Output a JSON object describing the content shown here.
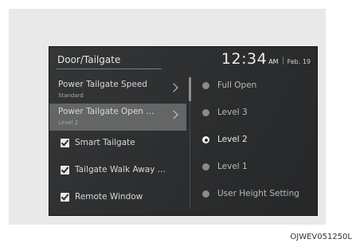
{
  "header": {
    "title": "Door/Tailgate",
    "time": "12:34",
    "ampm": "AM",
    "date": "Feb. 19"
  },
  "left_menu": [
    {
      "label": "Power Tailgate Speed",
      "sub": "Standard",
      "type": "submenu",
      "selected": false
    },
    {
      "label": "Power Tailgate Open ...",
      "sub": "Level 2",
      "type": "submenu",
      "selected": true
    },
    {
      "label": "Smart Tailgate",
      "type": "checkbox",
      "checked": true
    },
    {
      "label": "Tailgate Walk Away ...",
      "type": "checkbox",
      "checked": true
    },
    {
      "label": "Remote Window",
      "type": "checkbox",
      "checked": true
    }
  ],
  "options": [
    {
      "label": "Full Open",
      "selected": false
    },
    {
      "label": "Level 3",
      "selected": false
    },
    {
      "label": "Level 2",
      "selected": true
    },
    {
      "label": "Level 1",
      "selected": false
    },
    {
      "label": "User Height Setting",
      "selected": false
    }
  ],
  "figure_code": "OJWEV051250L",
  "colors": {
    "screen_bg": "#2f3133",
    "selected_row": "#636566",
    "frame_bg": "#e9e9e9"
  }
}
